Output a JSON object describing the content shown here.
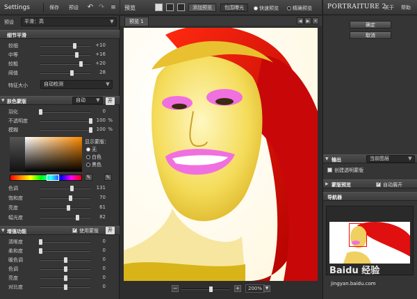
{
  "left": {
    "title": "Settings",
    "toolbar": {
      "save": "保存",
      "preset": "预设",
      "undo": "↶",
      "redo": "↷",
      "menu": "≡"
    },
    "preset_label": "预设",
    "preset_value": "平滑：高",
    "detail_section": {
      "title": "细节平滑",
      "sliders": [
        {
          "label": "较细",
          "value": "+10",
          "pos": 0.68
        },
        {
          "label": "中等",
          "value": "+16",
          "pos": 0.72
        },
        {
          "label": "较粗",
          "value": "+20",
          "pos": 0.8
        },
        {
          "label": "阈值",
          "value": "28",
          "pos": 0.62
        }
      ],
      "feature_size_label": "特征大小",
      "feature_size_value": "自动检测"
    },
    "skin_section": {
      "title": "肤色蒙版",
      "mode": "自动",
      "toggle": "开",
      "sliders": [
        {
          "label": "羽化",
          "value": "0",
          "unit": "",
          "pos": 0.0
        },
        {
          "label": "不透明度",
          "value": "100",
          "unit": "%",
          "pos": 1.0
        },
        {
          "label": "模糊",
          "value": "100",
          "unit": "%",
          "pos": 1.0
        }
      ],
      "display_label": "显示蒙版：",
      "radios": [
        {
          "label": "无",
          "on": true
        },
        {
          "label": "白色",
          "on": false
        },
        {
          "label": "黑色",
          "on": false
        }
      ],
      "color_sliders": [
        {
          "label": "色调",
          "value": "131",
          "pos": 0.62
        },
        {
          "label": "饱和度",
          "value": "70",
          "pos": 0.6
        },
        {
          "label": "亮度",
          "value": "61",
          "pos": 0.55
        },
        {
          "label": "幅光度",
          "value": "82",
          "pos": 0.74
        }
      ]
    },
    "enhance_section": {
      "title": "增强功能",
      "use_mask_label": "使用蒙版",
      "toggle": "开",
      "sliders": [
        {
          "label": "清晰度",
          "value": "0",
          "pos": 0.0
        },
        {
          "label": "柔和度",
          "value": "0",
          "pos": 0.0
        },
        {
          "label": "暖色调",
          "value": "0",
          "pos": 0.5
        },
        {
          "label": "色调",
          "value": "0",
          "pos": 0.5
        },
        {
          "label": "亮度",
          "value": "0",
          "pos": 0.5
        },
        {
          "label": "对比度",
          "value": "0",
          "pos": 0.5
        }
      ]
    }
  },
  "center": {
    "title": "预览",
    "add_preview": "添加预览",
    "contain_exposure": "包围曝光",
    "fast_preview": "快速预览",
    "accurate_preview": "精确预览",
    "tab": "预览 1",
    "zoom_minus": "−",
    "zoom_plus": "+",
    "zoom_value": "200%"
  },
  "right": {
    "brand": "PORTRAITURE 2",
    "about": "关于",
    "help": "帮助",
    "ok": "确定",
    "cancel": "取消",
    "output_label": "输出",
    "output_value": "当前图层",
    "create_transparent": "创建透明蒙版",
    "skin_preview": "蒙版预览",
    "auto_expand": "自动展开",
    "navigator": "导航器"
  },
  "watermark": {
    "main": "Baidu 经验",
    "sub": "jingyan.baidu.com"
  },
  "colors": {
    "lip": "#f070e0",
    "hair": "#e01010",
    "skin": "#f0d060"
  }
}
